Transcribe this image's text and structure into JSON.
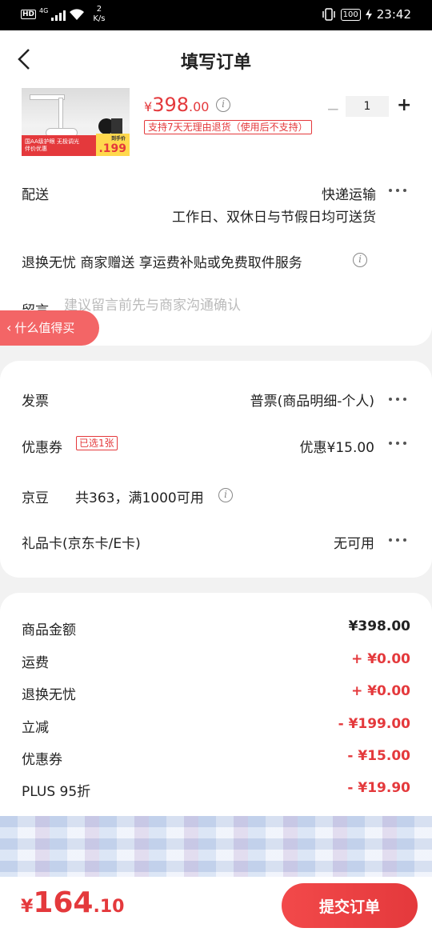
{
  "status_bar": {
    "hd": "HD",
    "network": "4G",
    "speed_value": "2",
    "speed_unit": "K/s",
    "battery": "100",
    "time": "23:42"
  },
  "header": {
    "title": "填写订单"
  },
  "product": {
    "image_banner_text": "国AA级护眼 无极调光",
    "image_banner_sub": "伴价优惠",
    "image_tag_label": "到手价",
    "image_tag_price": ".199",
    "price_symbol": "¥",
    "price_int": "398",
    "price_dec": ".00",
    "promo": "支持7天无理由退货（使用后不支持）",
    "quantity": "1",
    "minus": "−",
    "plus": "+"
  },
  "delivery": {
    "label": "配送",
    "value": "快递运输",
    "sub": "工作日、双休日与节假日均可送货"
  },
  "service": {
    "text": "退换无忧 商家赠送 享运费补贴或免费取件服务"
  },
  "message": {
    "label": "留言",
    "placeholder": "建议留言前先与商家沟通确认"
  },
  "float_tab": {
    "label": "什么值得买"
  },
  "invoice": {
    "label": "发票",
    "value": "普票(商品明细-个人)"
  },
  "coupon": {
    "label": "优惠券",
    "badge": "已选1张",
    "value": "优惠¥15.00"
  },
  "jingdou": {
    "label": "京豆",
    "value": "共363，满1000可用"
  },
  "giftcard": {
    "label": "礼品卡(京东卡/E卡)",
    "value": "无可用"
  },
  "summary": [
    {
      "label": "商品金额",
      "value": "¥398.00",
      "red": false
    },
    {
      "label": "运费",
      "value": "+ ¥0.00",
      "red": true
    },
    {
      "label": "退换无忧",
      "value": "+ ¥0.00",
      "red": true
    },
    {
      "label": "立减",
      "value": "- ¥199.00",
      "red": true
    },
    {
      "label": "优惠券",
      "value": "- ¥15.00",
      "red": true
    },
    {
      "label": "PLUS 95折",
      "value": "- ¥19.90",
      "red": true
    }
  ],
  "bottom": {
    "total_symbol": "¥",
    "total_int": "164",
    "total_dec": ".10",
    "submit_label": "提交订单"
  },
  "colors": {
    "accent": "#e4393c",
    "float_tab": "#f36566",
    "background": "#f2f2f2"
  }
}
